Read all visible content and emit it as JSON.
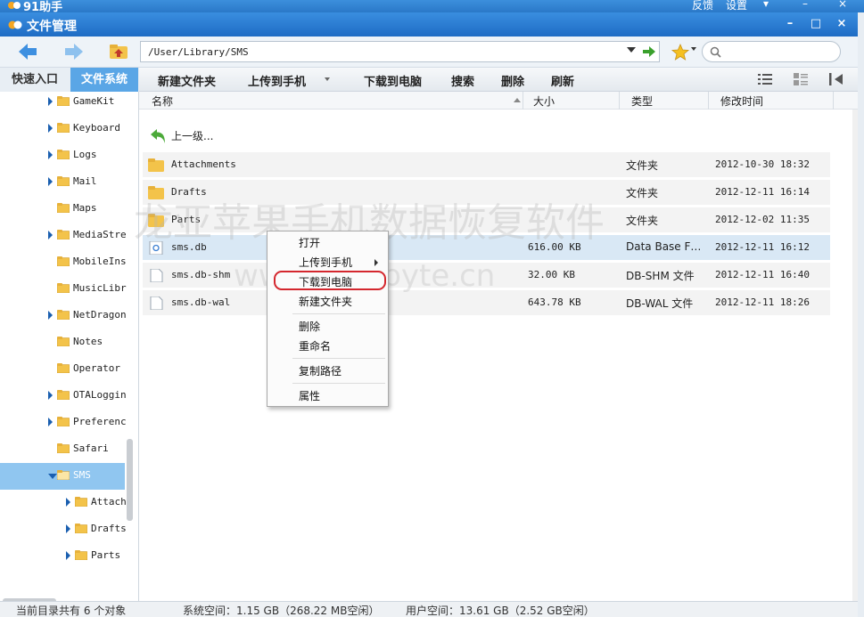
{
  "app": {
    "title": "91助手",
    "menu_feedback": "反馈",
    "menu_settings": "设置"
  },
  "window": {
    "title": "文件管理"
  },
  "address": {
    "path": "/User/Library/SMS"
  },
  "left_tabs": {
    "quick": "快速入口",
    "filesystem": "文件系统"
  },
  "toolbar": {
    "new_folder": "新建文件夹",
    "upload": "上传到手机",
    "download": "下载到电脑",
    "search": "搜索",
    "delete": "删除",
    "refresh": "刷新"
  },
  "tree": [
    {
      "label": "GameKit",
      "expandable": true
    },
    {
      "label": "Keyboard",
      "expandable": true
    },
    {
      "label": "Logs",
      "expandable": true
    },
    {
      "label": "Mail",
      "expandable": true
    },
    {
      "label": "Maps",
      "expandable": false
    },
    {
      "label": "MediaStre",
      "expandable": true
    },
    {
      "label": "MobileIns",
      "expandable": false
    },
    {
      "label": "MusicLibr",
      "expandable": false
    },
    {
      "label": "NetDragon",
      "expandable": true
    },
    {
      "label": "Notes",
      "expandable": false
    },
    {
      "label": "Operator",
      "expandable": false
    },
    {
      "label": "OTALoggin",
      "expandable": true
    },
    {
      "label": "Preferenc",
      "expandable": true
    },
    {
      "label": "Safari",
      "expandable": false
    },
    {
      "label": "SMS",
      "expandable": true,
      "selected": true
    },
    {
      "label": "Attach",
      "expandable": true,
      "child": true
    },
    {
      "label": "Drafts",
      "expandable": true,
      "child": true
    },
    {
      "label": "Parts",
      "expandable": true,
      "child": true
    }
  ],
  "columns": {
    "name": "名称",
    "size": "大小",
    "type": "类型",
    "modified": "修改时间"
  },
  "up_level": "上一级...",
  "files": [
    {
      "name": "Attachments",
      "size": "",
      "type": "文件夹",
      "modified": "2012-10-30 18:32",
      "kind": "folder"
    },
    {
      "name": "Drafts",
      "size": "",
      "type": "文件夹",
      "modified": "2012-12-11 16:14",
      "kind": "folder"
    },
    {
      "name": "Parts",
      "size": "",
      "type": "文件夹",
      "modified": "2012-12-02 11:35",
      "kind": "folder"
    },
    {
      "name": "sms.db",
      "size": "616.00 KB",
      "type": "Data Base F…",
      "modified": "2012-12-11 16:12",
      "kind": "db",
      "selected": true
    },
    {
      "name": "sms.db-shm",
      "size": "32.00 KB",
      "type": "DB-SHM 文件",
      "modified": "2012-12-11 16:40",
      "kind": "file"
    },
    {
      "name": "sms.db-wal",
      "size": "643.78 KB",
      "type": "DB-WAL 文件",
      "modified": "2012-12-11 18:26",
      "kind": "file"
    }
  ],
  "context_menu": {
    "open": "打开",
    "upload": "上传到手机",
    "download": "下载到电脑",
    "new_folder": "新建文件夹",
    "delete": "删除",
    "rename": "重命名",
    "copy_path": "复制路径",
    "properties": "属性"
  },
  "watermark": {
    "line1": "龙亚苹果手机数据恢复软件",
    "line2": "www.fonebyte.cn"
  },
  "status": {
    "count": "当前目录共有 6 个对象",
    "system_space": "系统空间：1.15 GB（268.22 MB空闲）",
    "user_space": "用户空间：13.61 GB（2.52 GB空闲）"
  },
  "colors": {
    "title_blue": "#2a78c8",
    "selected_tab": "#5aa6e6",
    "selected_tree": "#90c6f0",
    "selected_row": "#d9e8f5",
    "highlight_ring": "#d4272e",
    "folder": "#f3c34a"
  }
}
